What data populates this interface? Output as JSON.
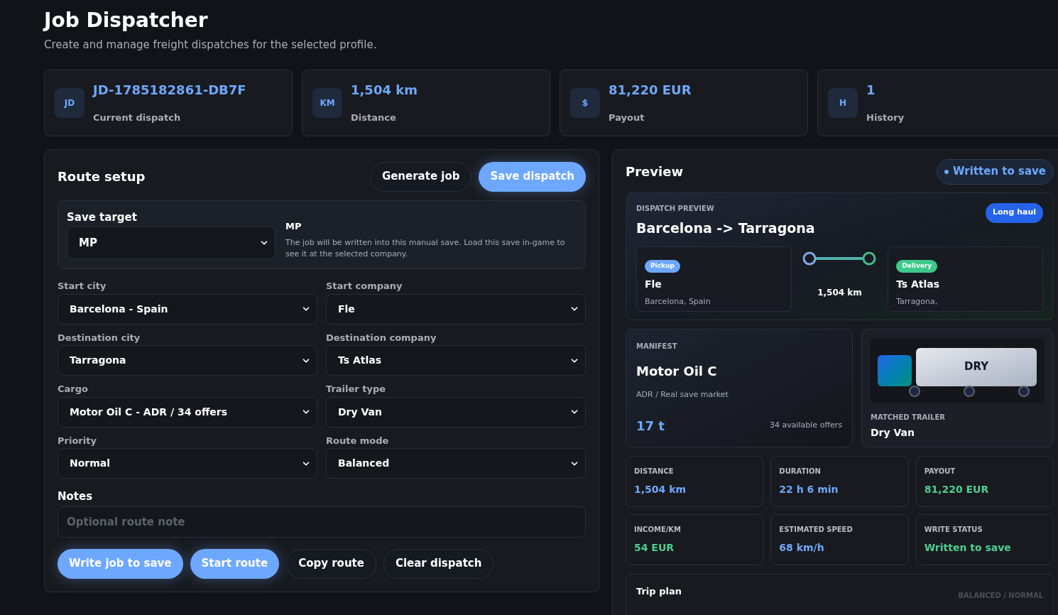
{
  "header": {
    "title": "Job Dispatcher",
    "subtitle": "Create and manage freight dispatches for the selected profile."
  },
  "stats": [
    {
      "badge": "JD",
      "value": "JD-1785182861-DB7F",
      "label": "Current dispatch"
    },
    {
      "badge": "KM",
      "value": "1,504 km",
      "label": "Distance"
    },
    {
      "badge": "$",
      "value": "81,220 EUR",
      "label": "Payout"
    },
    {
      "badge": "H",
      "value": "1",
      "label": "History"
    }
  ],
  "route_setup": {
    "title": "Route setup",
    "top_buttons": [
      {
        "label": "Generate job",
        "kind": "secondary"
      },
      {
        "label": "Save dispatch",
        "kind": "primary"
      }
    ],
    "save_target": {
      "label": "Save target",
      "value": "MP",
      "info_title": "MP",
      "info_text": "The job will be written into this manual save. Load this save in-game to see it at the selected company."
    },
    "fields": [
      {
        "label": "Start city",
        "value": "Barcelona - Spain"
      },
      {
        "label": "Start company",
        "value": "Fle"
      },
      {
        "label": "Destination city",
        "value": "Tarragona"
      },
      {
        "label": "Destination company",
        "value": "Ts Atlas"
      },
      {
        "label": "Cargo",
        "value": "Motor Oil C - ADR / 34 offers"
      },
      {
        "label": "Trailer type",
        "value": "Dry Van"
      },
      {
        "label": "Priority",
        "value": "Normal"
      },
      {
        "label": "Route mode",
        "value": "Balanced"
      }
    ],
    "notes": {
      "label": "Notes",
      "placeholder": "Optional route note"
    },
    "buttons": [
      {
        "label": "Write job to save",
        "kind": "primary"
      },
      {
        "label": "Start route",
        "kind": "primary"
      },
      {
        "label": "Copy route",
        "kind": "secondary"
      },
      {
        "label": "Clear dispatch",
        "kind": "secondary"
      }
    ]
  },
  "preview": {
    "title": "Preview",
    "status": "Written to save",
    "dispatch": {
      "eyebrow": "DISPATCH PREVIEW",
      "route": "Barcelona -> Tarragona",
      "tag": "Long haul",
      "distance": "1,504 km",
      "stops": [
        {
          "kind": "pickup",
          "badge": "Pickup",
          "company": "Fle",
          "place": "Barcelona, Spain"
        },
        {
          "kind": "delivery",
          "badge": "Delivery",
          "company": "Ts Atlas",
          "place": "Tarragona,"
        }
      ]
    },
    "manifest": {
      "eyebrow": "MANIFEST",
      "cargo": "Motor Oil C",
      "detail": "ADR / Real save market",
      "weight": "17 t",
      "offers": "34 available offers"
    },
    "trailer": {
      "plate": "DRY",
      "eyebrow": "MATCHED TRAILER",
      "name": "Dry Van"
    },
    "metrics": [
      {
        "label": "DISTANCE",
        "value": "1,504 km",
        "color": "#6ea8fe"
      },
      {
        "label": "DURATION",
        "value": "22 h 6 min",
        "color": "#6ea8fe"
      },
      {
        "label": "PAYOUT",
        "value": "81,220 EUR",
        "color": "#4ccf8f"
      },
      {
        "label": "INCOME/KM",
        "value": "54 EUR",
        "color": "#4ccf8f"
      },
      {
        "label": "ESTIMATED SPEED",
        "value": "68 km/h",
        "color": "#6ea8fe"
      },
      {
        "label": "WRITE STATUS",
        "value": "Written to save",
        "color": "#4ccf8f"
      }
    ],
    "trip_plan": {
      "title": "Trip plan",
      "mode": "BALANCED / NORMAL"
    }
  }
}
